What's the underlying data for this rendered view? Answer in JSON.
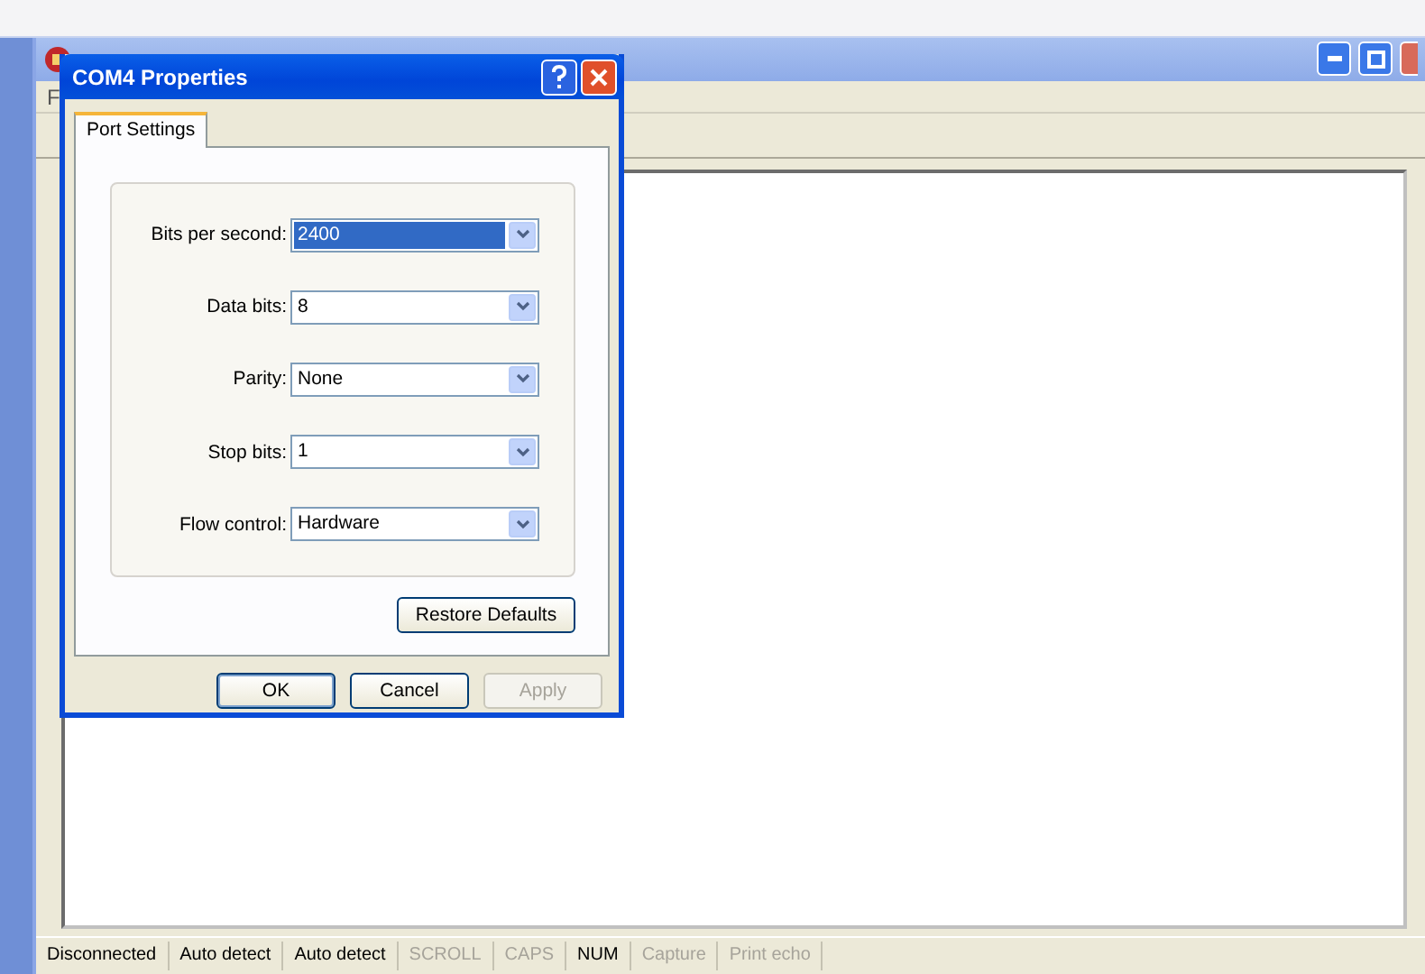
{
  "terminal_window": {
    "menu": [
      "F"
    ]
  },
  "dialog": {
    "title": "COM4 Properties",
    "tabs": [
      {
        "label": "Port Settings",
        "selected": true
      }
    ],
    "settings": [
      {
        "label": "Bits per second:",
        "value": "2400",
        "highlighted": true
      },
      {
        "label": "Data bits:",
        "value": "8",
        "highlighted": false
      },
      {
        "label": "Parity:",
        "value": "None",
        "highlighted": false
      },
      {
        "label": "Stop bits:",
        "value": "1",
        "highlighted": false
      },
      {
        "label": "Flow control:",
        "value": "Hardware",
        "highlighted": false
      }
    ],
    "restore_button": "Restore Defaults",
    "buttons": [
      {
        "label": "OK",
        "disabled": false,
        "default": true
      },
      {
        "label": "Cancel",
        "disabled": false,
        "default": false
      },
      {
        "label": "Apply",
        "disabled": true,
        "default": false
      }
    ]
  },
  "status_bar": [
    {
      "text": "Disconnected",
      "disabled": false
    },
    {
      "text": "Auto detect",
      "disabled": false
    },
    {
      "text": "Auto detect",
      "disabled": false
    },
    {
      "text": "SCROLL",
      "disabled": true
    },
    {
      "text": "CAPS",
      "disabled": true
    },
    {
      "text": "NUM",
      "disabled": false
    },
    {
      "text": "Capture",
      "disabled": true
    },
    {
      "text": "Print echo",
      "disabled": true
    }
  ]
}
